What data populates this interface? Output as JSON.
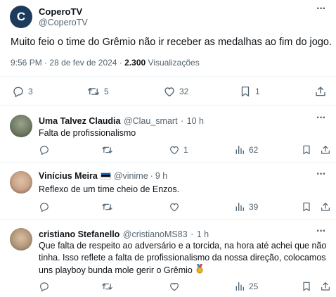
{
  "post": {
    "display_name": "CoperoTV",
    "handle": "@CoperoTV",
    "avatar_letter": "C",
    "text": "Muito feio o time do Grêmio não ir receber as medalhas ao fim do jogo.",
    "time": "9:56 PM",
    "date": "28 de fev de 2024",
    "views_count": "2.300",
    "views_label": "Visualizações",
    "replies": "3",
    "reposts": "5",
    "likes": "32",
    "bookmarks": "1",
    "more_glyph": "···",
    "separator": "·"
  },
  "replies": [
    {
      "name": "Uma Talvez Claudia",
      "handle": "@Clau_smart",
      "time": "10 h",
      "text": "Falta de profissionalismo",
      "replies": "",
      "reposts": "",
      "likes": "1",
      "views": "62",
      "avatar_color": "#6f7a64"
    },
    {
      "name": "Vinícius Meira",
      "flag": "Estonia flag",
      "handle": "@vinime",
      "time": "9 h",
      "text": "Reflexo de um time cheio de Enzos.",
      "replies": "",
      "reposts": "",
      "likes": "",
      "views": "39",
      "avatar_color": "#c9a489"
    },
    {
      "name": "cristiano Stefanello",
      "handle": "@cristianoMS83",
      "time": "1 h",
      "text_lines": [
        "Que falta de respeito ao adversário e a torcida, na hora até achei que não",
        "tinha. Isso reflete a falta de profissionalismo da nossa direção, colocamos",
        "uns playboy bunda mole gerir o Grêmio"
      ],
      "replies": "",
      "reposts": "",
      "likes": "",
      "views": "25",
      "avatar_color": "#b89a7d"
    }
  ],
  "colors": {
    "text_primary": "#0f1419",
    "text_secondary": "#536471",
    "divider": "#eff3f4",
    "avatar_bg": "#1d3b5c"
  }
}
